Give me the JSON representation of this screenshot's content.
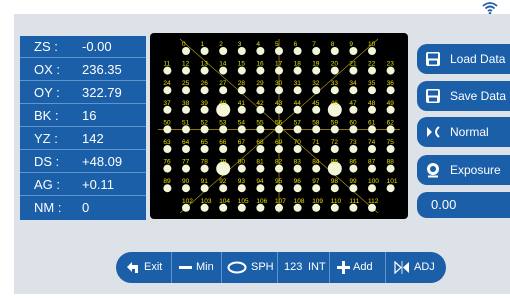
{
  "readouts": [
    {
      "label": "ZS :",
      "value": "-0.00"
    },
    {
      "label": "OX :",
      "value": "236.35"
    },
    {
      "label": "OY :",
      "value": "322.79"
    },
    {
      "label": "BK :",
      "value": "16"
    },
    {
      "label": "YZ :",
      "value": "142"
    },
    {
      "label": "DS :",
      "value": "+48.09"
    },
    {
      "label": "AG :",
      "value": "+0.11"
    },
    {
      "label": "NM :",
      "value": "0"
    }
  ],
  "side_buttons": {
    "load_data": "Load Data",
    "save_data": "Save Data",
    "normal": "Normal",
    "exposure": "Exposure",
    "value": "0.00"
  },
  "toolbar": {
    "exit": "Exit",
    "min": "Min",
    "sph": "SPH",
    "int_prefix": "123",
    "int": "INT",
    "add": "Add",
    "adj": "ADJ"
  },
  "dot_grid": {
    "rows": [
      {
        "labels": [
          "0",
          "1",
          "2",
          "3",
          "4",
          "5",
          "6",
          "7",
          "8",
          "9",
          "10"
        ]
      },
      {
        "labels": [
          "11",
          "12",
          "13",
          "14",
          "15",
          "16",
          "17",
          "18",
          "19",
          "20",
          "21",
          "22",
          "23"
        ]
      },
      {
        "labels": [
          "24",
          "25",
          "26",
          "27",
          "28",
          "29",
          "30",
          "31",
          "32",
          "33",
          "34",
          "35",
          "36"
        ]
      },
      {
        "labels": [
          "37",
          "38",
          "39",
          "40",
          "41",
          "42",
          "43",
          "44",
          "45",
          "46",
          "47",
          "48",
          "49"
        ]
      },
      {
        "labels": [
          "50",
          "51",
          "52",
          "53",
          "54",
          "55",
          "56",
          "57",
          "58",
          "59",
          "60",
          "61",
          "62"
        ]
      },
      {
        "labels": [
          "63",
          "64",
          "65",
          "66",
          "67",
          "68",
          "69",
          "70",
          "71",
          "72",
          "73",
          "74",
          "75"
        ]
      },
      {
        "labels": [
          "76",
          "77",
          "78",
          "79",
          "80",
          "81",
          "82",
          "83",
          "84",
          "85",
          "86",
          "87",
          "88"
        ]
      },
      {
        "labels": [
          "89",
          "90",
          "91",
          "92",
          "93",
          "94",
          "95",
          "96",
          "97",
          "98",
          "99",
          "100",
          "101"
        ]
      },
      {
        "labels": [
          "102",
          "103",
          "104",
          "105",
          "106",
          "107",
          "108",
          "109",
          "110",
          "111",
          "112"
        ]
      }
    ],
    "dot_color": "#f2f7d9",
    "label_color": "#e8e000",
    "grid_line_color": "#b8a010"
  },
  "colors": {
    "panel": "#1a5fa8",
    "background": "#dde2e8"
  }
}
